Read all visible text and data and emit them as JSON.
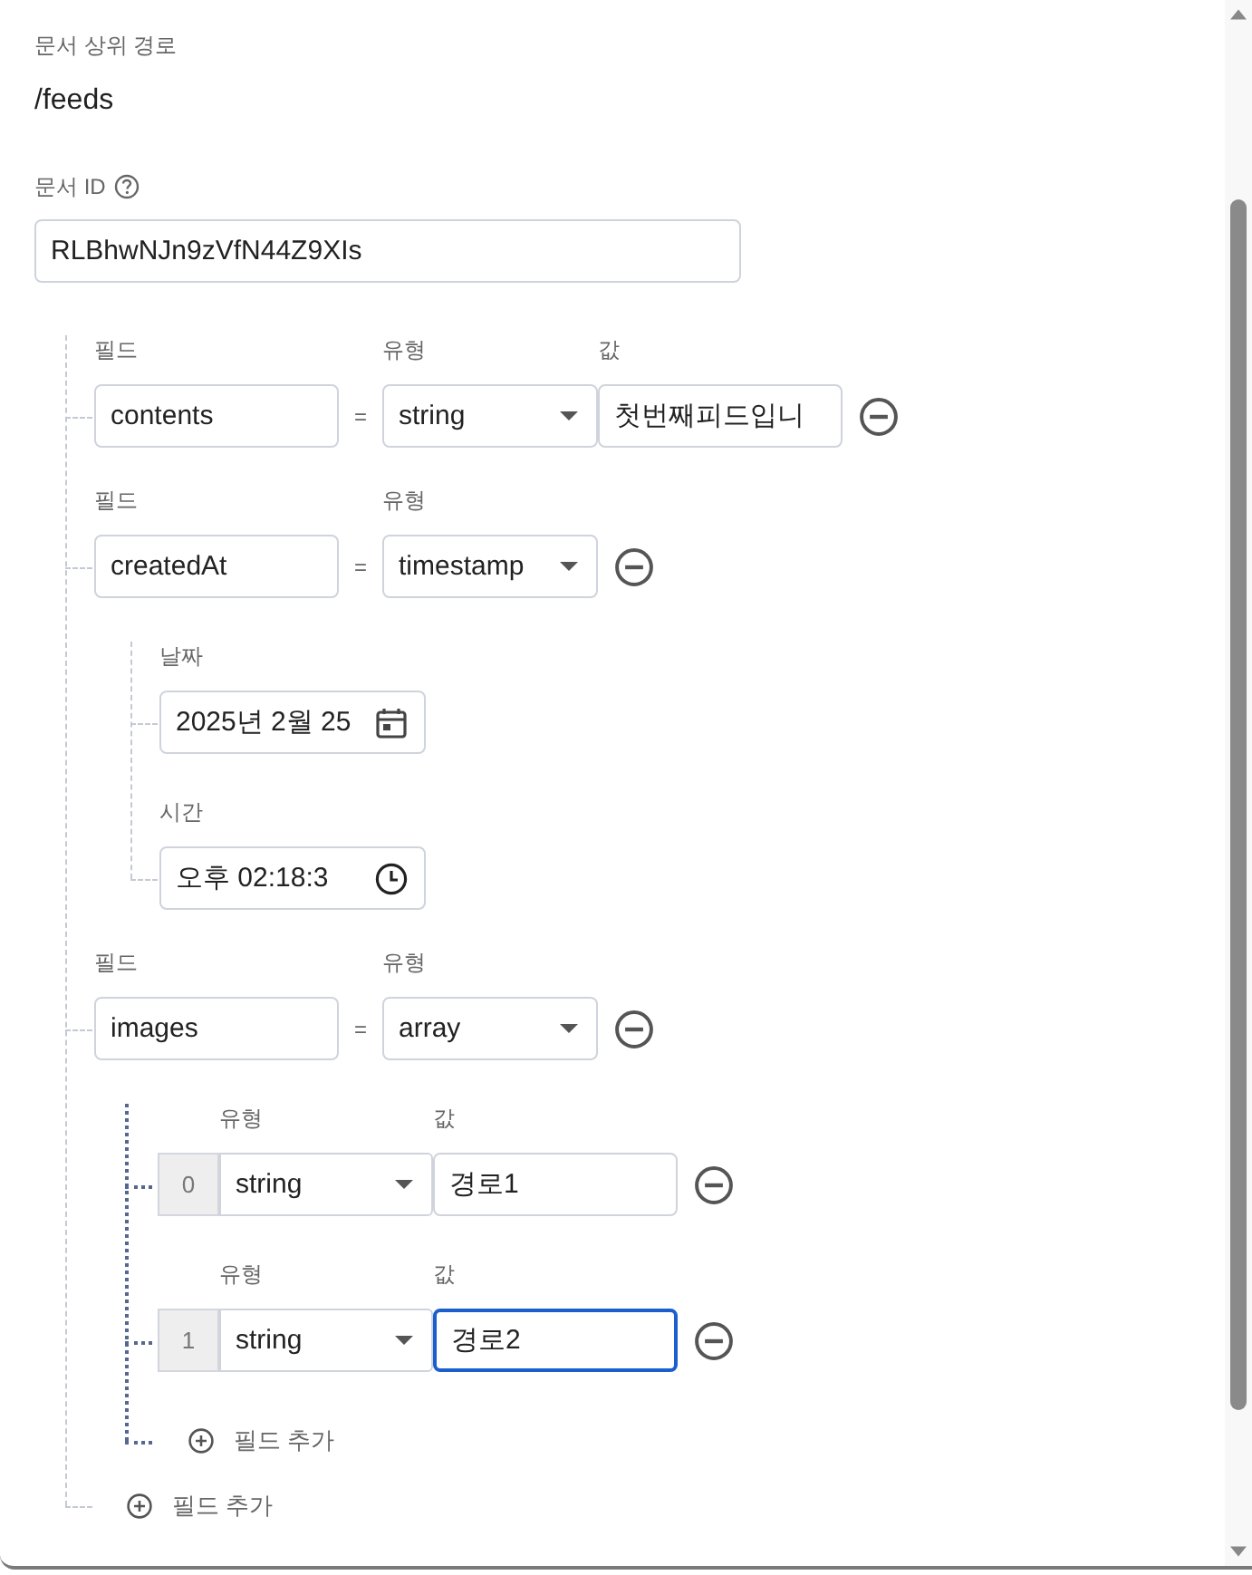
{
  "parent_path": {
    "label": "문서 상위 경로",
    "value": "/feeds"
  },
  "document_id": {
    "label": "문서 ID",
    "value": "RLBhwNJn9zVfN44Z9XIs"
  },
  "fields": [
    {
      "kind": "simple",
      "name_label": "필드",
      "type_label": "유형",
      "value_label": "값",
      "name": "contents",
      "equals": "=",
      "type": "string",
      "value": "첫번째피드입니"
    },
    {
      "kind": "timestamp",
      "name_label": "필드",
      "type_label": "유형",
      "name": "createdAt",
      "equals": "=",
      "type": "timestamp",
      "date_label": "날짜",
      "date": "2025년 2월 25",
      "time_label": "시간",
      "time": "오후 02:18:3"
    },
    {
      "kind": "array",
      "name_label": "필드",
      "type_label": "유형",
      "name": "images",
      "equals": "=",
      "type": "array",
      "items": [
        {
          "index": "0",
          "type_label": "유형",
          "value_label": "값",
          "type": "string",
          "value": "경로1",
          "focused": false
        },
        {
          "index": "1",
          "type_label": "유형",
          "value_label": "값",
          "type": "string",
          "value": "경로2",
          "focused": true
        }
      ],
      "add_label": "필드 추가"
    }
  ],
  "add_label": "필드 추가"
}
